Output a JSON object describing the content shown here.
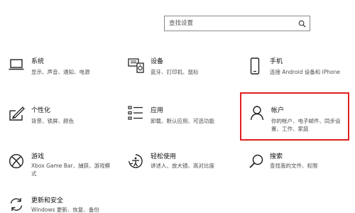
{
  "search": {
    "placeholder": "查找设置"
  },
  "tiles": [
    {
      "id": "system",
      "title": "系统",
      "desc": "显示、声音、通知、电源",
      "icon": "laptop-icon"
    },
    {
      "id": "devices",
      "title": "设备",
      "desc": "蓝牙、打印机、鼠标",
      "icon": "keyboard-speaker-icon"
    },
    {
      "id": "phone",
      "title": "手机",
      "desc": "连接 Android 设备和 iPhone",
      "icon": "phone-icon"
    },
    {
      "id": "personalization",
      "title": "个性化",
      "desc": "背景、锁屏、颜色",
      "icon": "paint-brush-icon"
    },
    {
      "id": "apps",
      "title": "应用",
      "desc": "卸载、默认应用、可选功能",
      "icon": "apps-list-icon"
    },
    {
      "id": "accounts",
      "title": "帐户",
      "desc": "你的帐户、电子邮件、同步设置、工作、家庭",
      "icon": "person-icon",
      "selected": true
    },
    {
      "id": "gaming",
      "title": "游戏",
      "desc": "Xbox Game Bar、捕获、游戏模式",
      "icon": "xbox-icon"
    },
    {
      "id": "ease",
      "title": "轻松使用",
      "desc": "讲述人、放大镜、高对比度",
      "icon": "ease-of-access-icon"
    },
    {
      "id": "search",
      "title": "搜索",
      "desc": "查找我的文件、权限",
      "icon": "magnifier-icon"
    },
    {
      "id": "update",
      "title": "更新和安全",
      "desc": "Windows 更新、恢复、备份",
      "icon": "sync-arrows-icon"
    }
  ],
  "colors": {
    "selection_border": "#e02020",
    "icon_stroke": "#222222"
  }
}
